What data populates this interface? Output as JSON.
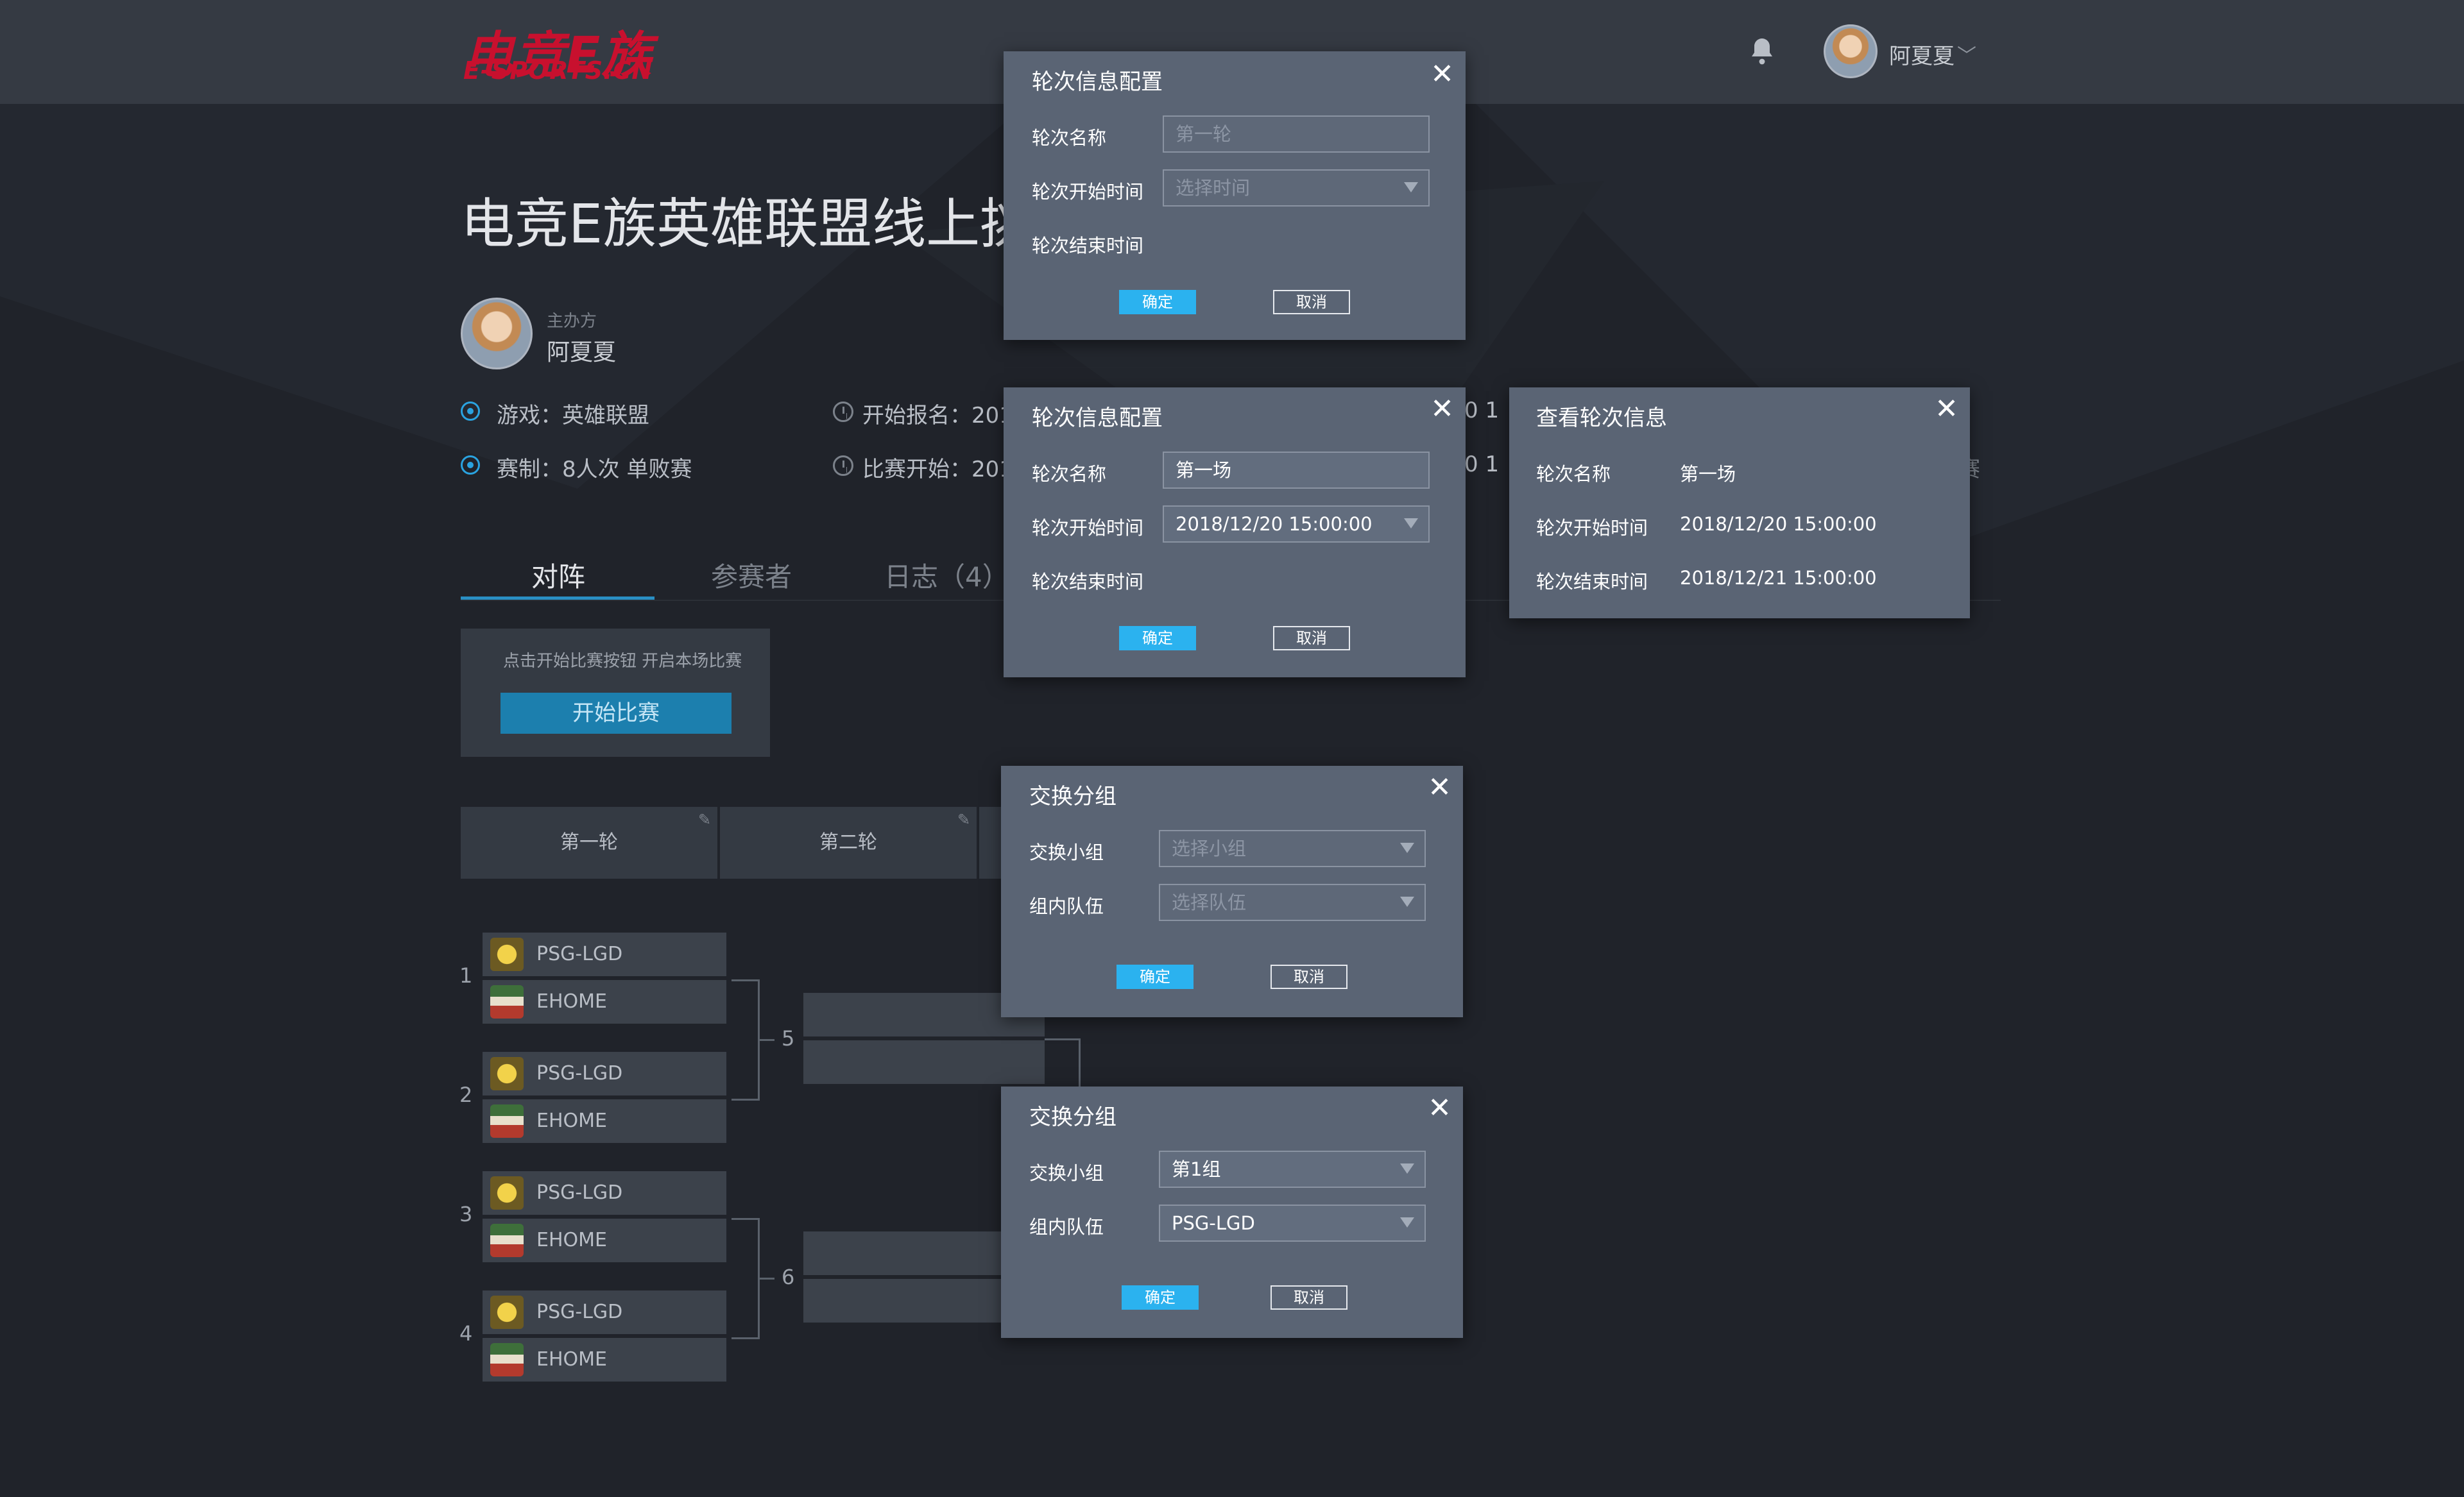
{
  "header": {
    "logo_main": "电竞E族",
    "logo_sub": "E-SPORTS.CN",
    "user_name": "阿夏夏",
    "caret": "﹀",
    "bell_icon": "bell-icon"
  },
  "event": {
    "title": "电竞E族英雄联盟线上挑",
    "organizer_label": "主办方",
    "organizer_name": "阿夏夏",
    "game": "游戏：英雄联盟",
    "format": "赛制：8人次  单败赛",
    "signup": "开始报名：201",
    "match_start": "比赛开始：201",
    "peek_top": "0  1",
    "peek_bottom": "0  1"
  },
  "tabs": [
    {
      "label": "对阵",
      "active": true
    },
    {
      "label": "参赛者",
      "active": false
    },
    {
      "label": "日志（4）",
      "active": false
    }
  ],
  "start_panel": {
    "hint": "点击开始比赛按钮  开启本场比赛",
    "button": "开始比赛"
  },
  "rounds": {
    "round1": "第一轮",
    "round2": "第二轮",
    "edit_icon": "✎"
  },
  "matches": [
    {
      "num": "1",
      "teams": [
        "PSG-LGD",
        "EHOME"
      ]
    },
    {
      "num": "2",
      "teams": [
        "PSG-LGD",
        "EHOME"
      ]
    },
    {
      "num": "3",
      "teams": [
        "PSG-LGD",
        "EHOME"
      ]
    },
    {
      "num": "4",
      "teams": [
        "PSG-LGD",
        "EHOME"
      ]
    }
  ],
  "next_matches": [
    "5",
    "6"
  ],
  "round_config_empty": {
    "title": "轮次信息配置",
    "close": "✕",
    "name_label": "轮次名称",
    "name_placeholder": "第一轮",
    "start_label": "轮次开始时间",
    "start_placeholder": "选择时间",
    "end_label": "轮次结束时间",
    "ok": "确定",
    "cancel": "取消"
  },
  "round_config_filled": {
    "title": "轮次信息配置",
    "close": "✕",
    "name_label": "轮次名称",
    "name_value": "第一场",
    "start_label": "轮次开始时间",
    "start_value": "2018/12/20  15:00:00",
    "end_label": "轮次结束时间",
    "ok": "确定",
    "cancel": "取消"
  },
  "round_view": {
    "title": "查看轮次信息",
    "close": "✕",
    "name_label": "轮次名称",
    "name_value": "第一场",
    "start_label": "轮次开始时间",
    "start_value": "2018/12/20  15:00:00",
    "end_label": "轮次结束时间",
    "end_value": "2018/12/21  15:00:00",
    "peek_right": "赛"
  },
  "swap_empty": {
    "title": "交换分组",
    "close": "✕",
    "group_label": "交换小组",
    "group_placeholder": "选择小组",
    "team_label": "组内队伍",
    "team_placeholder": "选择队伍",
    "ok": "确定",
    "cancel": "取消"
  },
  "swap_filled": {
    "title": "交换分组",
    "close": "✕",
    "group_label": "交换小组",
    "group_value": "第1组",
    "team_label": "组内队伍",
    "team_value": "PSG-LGD",
    "ok": "确定",
    "cancel": "取消"
  },
  "colors": {
    "accent": "#2aa3e0",
    "ok_button": "#2bb2ef",
    "start_button": "#1c7fae",
    "modal_bg": "#5a6474",
    "logo_red": "#c8102e"
  }
}
